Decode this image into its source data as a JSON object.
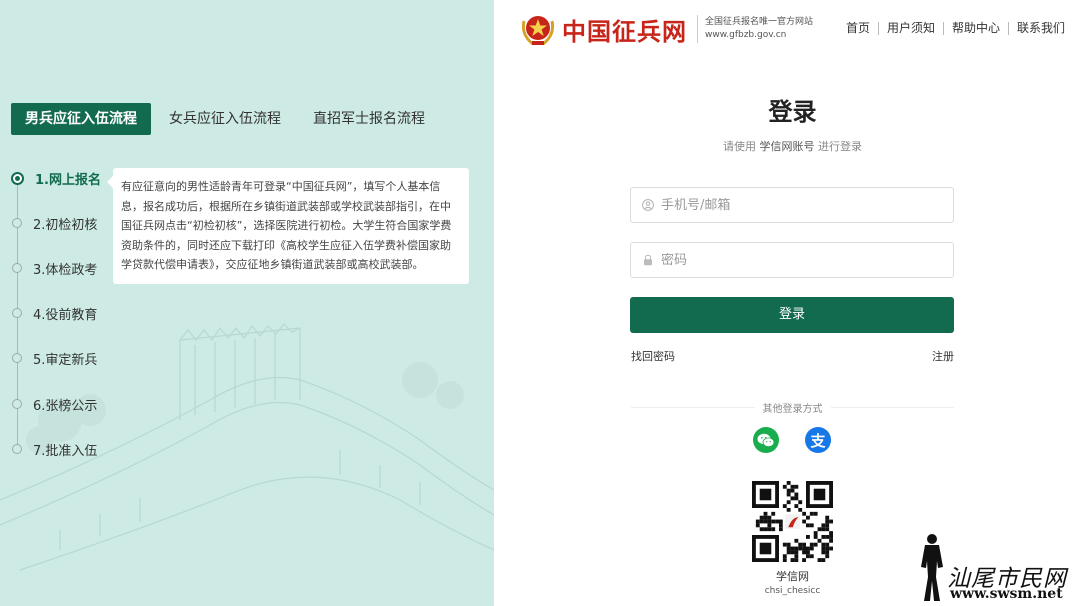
{
  "site": {
    "title": "中国征兵网",
    "tagline": "全国征兵报名唯一官方网站",
    "domain": "www.gfbzb.gov.cn"
  },
  "nav": [
    {
      "label": "首页"
    },
    {
      "label": "用户须知"
    },
    {
      "label": "帮助中心"
    },
    {
      "label": "联系我们"
    }
  ],
  "flow_tabs": [
    {
      "label": "男兵应征入伍流程",
      "active": true
    },
    {
      "label": "女兵应征入伍流程",
      "active": false
    },
    {
      "label": "直招军士报名流程",
      "active": false
    }
  ],
  "steps": [
    {
      "label": "1.网上报名",
      "active": true
    },
    {
      "label": "2.初检初核",
      "active": false
    },
    {
      "label": "3.体检政考",
      "active": false
    },
    {
      "label": "4.役前教育",
      "active": false
    },
    {
      "label": "5.审定新兵",
      "active": false
    },
    {
      "label": "6.张榜公示",
      "active": false
    },
    {
      "label": "7.批准入伍",
      "active": false
    }
  ],
  "step_description": "有应征意向的男性适龄青年可登录“中国征兵网”，填写个人基本信息，报名成功后，根据所在乡镇街道武装部或学校武装部指引，在中国征兵网点击“初检初核”，选择医院进行初检。大学生符合国家学费资助条件的，同时还应下载打印《高校学生应征入伍学费补偿国家助学贷款代偿申请表》，交应征地乡镇街道武装部或高校武装部。",
  "login": {
    "title": "登录",
    "subtitle_prefix": "请使用",
    "subtitle_highlight": "学信网账号",
    "subtitle_suffix": "进行登录",
    "username_placeholder": "手机号/邮箱",
    "password_placeholder": "密码",
    "submit_label": "登录",
    "forgot_label": "找回密码",
    "register_label": "注册",
    "other_methods_label": "其他登录方式",
    "sso": [
      {
        "name": "wechat",
        "icon": "wechat-icon"
      },
      {
        "name": "alipay",
        "icon": "alipay-icon",
        "glyph": "支"
      }
    ]
  },
  "qr": {
    "name": "学信网",
    "id": "chsi_chesicc"
  },
  "watermark": {
    "text": "汕尾市民网",
    "url": "www.swsm.net"
  },
  "colors": {
    "primary": "#126b4f",
    "left_bg": "#cdeae4",
    "brand_red": "#c8251a",
    "wechat": "#1aad4e",
    "alipay": "#1677e6"
  }
}
